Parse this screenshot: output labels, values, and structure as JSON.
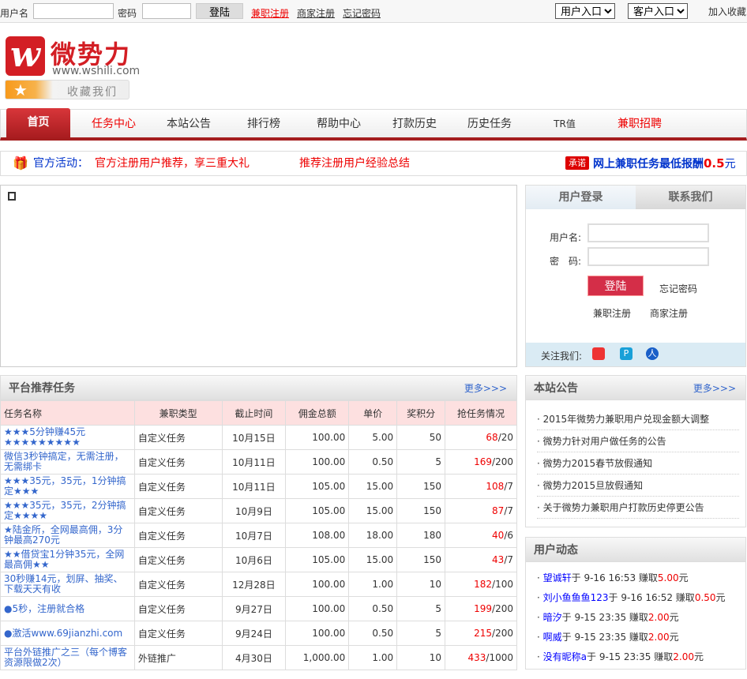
{
  "topbar": {
    "username_label": "用户名",
    "password_label": "密码",
    "login_button": "登陆",
    "links": [
      "兼职注册",
      "商家注册",
      "忘记密码"
    ],
    "user_entry": "用户入口",
    "merchant_entry": "客户入口",
    "join_favorites": "加入收藏"
  },
  "logo": {
    "name": "微势力",
    "url": "www.wshili.com",
    "favorite": "收藏我们"
  },
  "nav": [
    "首页",
    "任务中心",
    "本站公告",
    "排行榜",
    "帮助中心",
    "打款历史",
    "历史任务",
    "TR值",
    "兼职招聘"
  ],
  "activity": {
    "label": "官方活动：",
    "items": [
      "官方注册用户推荐，享三重大礼",
      "推荐注册用户经验总结"
    ],
    "badge": "承诺",
    "promise_text": "网上兼职任务最低报酬",
    "promise_value": "0.5",
    "promise_unit": "元"
  },
  "login": {
    "tabs": [
      "用户登录",
      "联系我们"
    ],
    "username_label": "用户名:",
    "password_label": "密　码:",
    "login_button": "登陆",
    "forgot": "忘记密码",
    "links": [
      "兼职注册",
      "商家注册"
    ],
    "follow_label": "关注我们:"
  },
  "tasks": {
    "title": "平台推荐任务",
    "more": "更多>>>",
    "headers": [
      "任务名称",
      "兼职类型",
      "截止时间",
      "佣金总额",
      "单价",
      "奖积分",
      "抢任务情况"
    ],
    "rows": [
      [
        "★★★5分钟赚45元★★★★★★★★★",
        "自定义任务",
        "10月15日",
        "100.00",
        "5.00",
        "50",
        "68",
        "/20"
      ],
      [
        "微信3秒钟搞定，无需注册，无需绑卡",
        "自定义任务",
        "10月11日",
        "100.00",
        "0.50",
        "5",
        "169",
        "/200"
      ],
      [
        "★★★35元，35元，1分钟搞定★★★",
        "自定义任务",
        "10月11日",
        "105.00",
        "15.00",
        "150",
        "108",
        "/7"
      ],
      [
        "★★★35元，35元，2分钟搞定★★★★",
        "自定义任务",
        "10月9日",
        "105.00",
        "15.00",
        "150",
        "87",
        "/7"
      ],
      [
        "★陆金所，全网最高佣，3分钟最高270元",
        "自定义任务",
        "10月7日",
        "108.00",
        "18.00",
        "180",
        "40",
        "/6"
      ],
      [
        "★★借贷宝1分钟35元，全网最高佣★★",
        "自定义任务",
        "10月6日",
        "105.00",
        "15.00",
        "150",
        "43",
        "/7"
      ],
      [
        "30秒赚14元，划屏、抽奖、下载天天有收",
        "自定义任务",
        "12月28日",
        "100.00",
        "1.00",
        "10",
        "182",
        "/100"
      ],
      [
        "●5秒，注册就合格",
        "自定义任务",
        "9月27日",
        "100.00",
        "0.50",
        "5",
        "199",
        "/200"
      ],
      [
        "●激活www.69jianzhi.com",
        "自定义任务",
        "9月24日",
        "100.00",
        "0.50",
        "5",
        "215",
        "/200"
      ],
      [
        "平台外链推广之三（每个博客资源限做2次）",
        "外链推广",
        "4月30日",
        "1,000.00",
        "1.00",
        "10",
        "433",
        "/1000"
      ]
    ]
  },
  "notices": {
    "title": "本站公告",
    "more": "更多>>>",
    "items": [
      "2015年微势力兼职用户兑现金额大调整",
      "微势力针对用户做任务的公告",
      "微势力2015春节放假通知",
      "微势力2015旦放假通知",
      "关于微势力兼职用户打款历史停更公告"
    ]
  },
  "dynamics": {
    "title": "用户动态",
    "items": [
      {
        "user": "望诚轩",
        "time": "于 9-16 16:53 赚取",
        "amount": "5.00",
        "unit": "元"
      },
      {
        "user": "刘小鱼鱼鱼123",
        "time": "于 9-16 16:52 赚取",
        "amount": "0.50",
        "unit": "元"
      },
      {
        "user": "暗汐",
        "time": "于 9-15 23:35 赚取",
        "amount": "2.00",
        "unit": "元"
      },
      {
        "user": "啊威",
        "time": "于 9-15 23:35 赚取",
        "amount": "2.00",
        "unit": "元"
      },
      {
        "user": "没有昵称a",
        "time": "于 9-15 23:35 赚取",
        "amount": "2.00",
        "unit": "元"
      }
    ]
  }
}
